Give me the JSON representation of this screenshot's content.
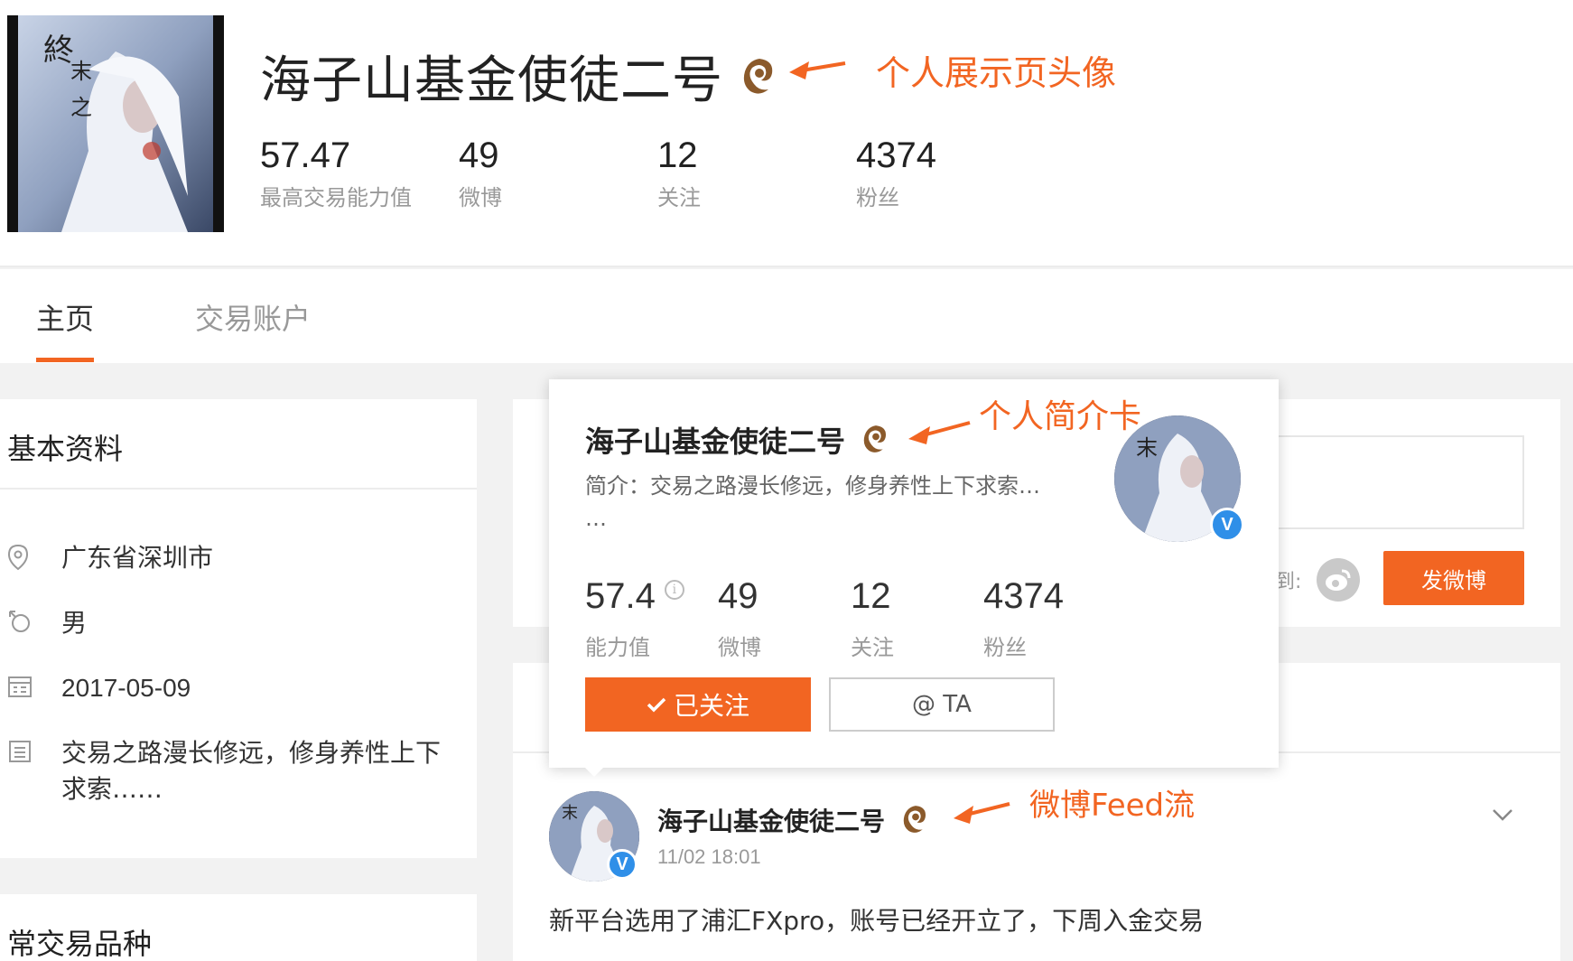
{
  "profile": {
    "name": "海子山基金使徒二号",
    "stats": [
      {
        "value": "57.47",
        "label": "最高交易能力值"
      },
      {
        "value": "49",
        "label": "微博"
      },
      {
        "value": "12",
        "label": "关注"
      },
      {
        "value": "4374",
        "label": "粉丝"
      }
    ]
  },
  "annotations": {
    "avatar": "个人展示页头像",
    "card": "个人简介卡",
    "feed": "微博Feed流"
  },
  "tabs": [
    {
      "label": "主页",
      "active": true
    },
    {
      "label": "交易账户",
      "active": false
    }
  ],
  "basic_info": {
    "title": "基本资料",
    "location": "广东省深圳市",
    "gender": "男",
    "date": "2017-05-09",
    "bio": "交易之路漫长修远，修身养性上下求索……"
  },
  "trading_card": {
    "title": "常交易品种"
  },
  "composer": {
    "sync_label": "到:",
    "post_button": "发微博"
  },
  "popup": {
    "name": "海子山基金使徒二号",
    "bio": "简介：交易之路漫长修远，修身养性上下求索…",
    "bio_more": "…",
    "stats": [
      {
        "value": "57.4",
        "label": "能力值"
      },
      {
        "value": "49",
        "label": "微博"
      },
      {
        "value": "12",
        "label": "关注"
      },
      {
        "value": "4374",
        "label": "粉丝"
      }
    ],
    "follow_button": "已关注",
    "at_button": "@ TA",
    "verified_mark": "V"
  },
  "feed": {
    "name": "海子山基金使徒二号",
    "time": "11/02 18:01",
    "text": "新平台选用了浦汇FXpro，账号已经开立了，下周入金交易",
    "verified_mark": "V"
  },
  "colors": {
    "accent": "#f26522",
    "verified": "#2f8fe8",
    "badge": "#8b5a2b"
  }
}
